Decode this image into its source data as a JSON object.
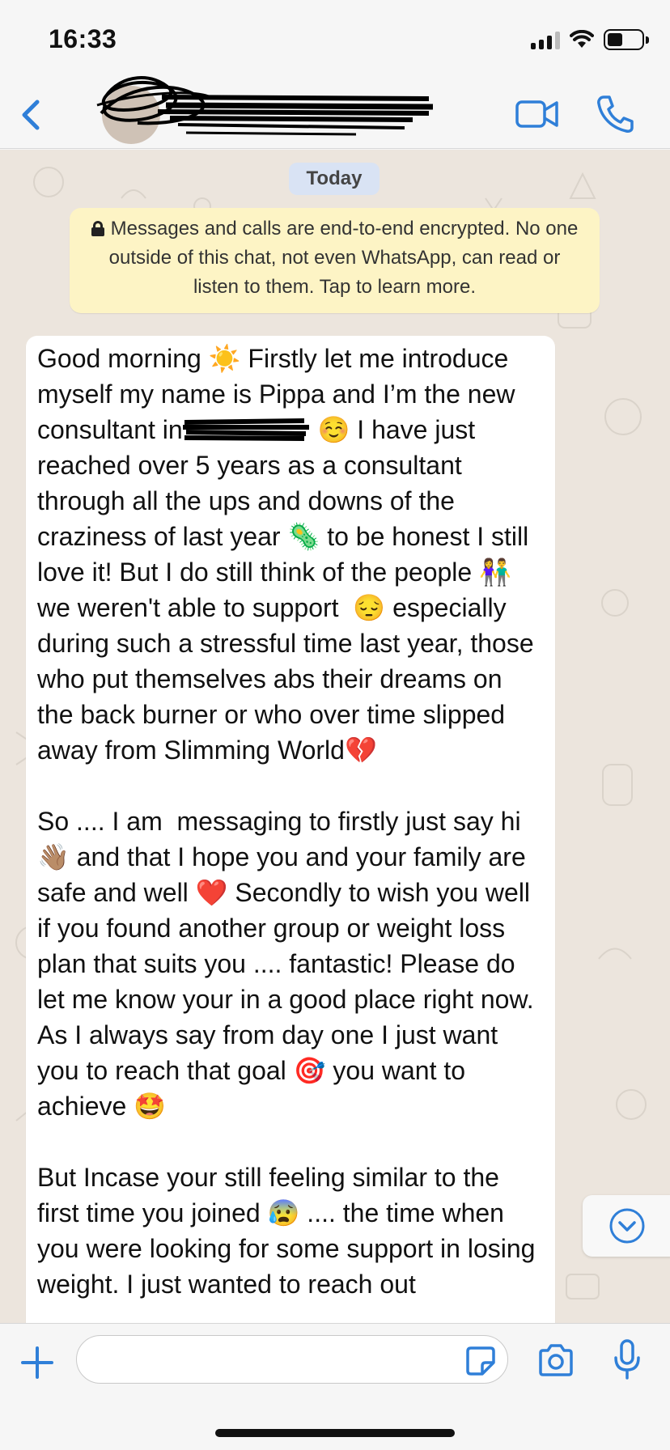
{
  "status_bar": {
    "time": "16:33",
    "battery_level": 0.45,
    "signal_bars": 3
  },
  "header": {
    "back_icon": "chevron-left-icon",
    "video_icon": "video-camera-icon",
    "call_icon": "phone-icon",
    "accent_color": "#2f7fd8"
  },
  "chat": {
    "date_chip": "Today",
    "encryption_notice": "Messages and calls are end-to-end encrypted. No one outside of this chat, not even WhatsApp, can read or listen to them. Tap to learn more.",
    "message": {
      "part1": "Good morning ☀️ Firstly let me introduce myself my name is Pippa and I’m the new consultant in",
      "part2": " ☺️ I have just reached over 5 years as a consultant through all the ups and downs of the craziness of last year 🦠 to be honest I still love it! But I do still think of the people 👫we weren't able to support  😔 especially during such a stressful time last year, those who put themselves abs their dreams on the back burner or who over time slipped away from Slimming World💔\n\nSo .... I am  messaging to firstly just say hi 👋🏽 and that I hope you and your family are safe and well ❤️ Secondly to wish you well if you found another group or weight loss plan that suits you .... fantastic! Please do let me know your in a good place right now. As I always say from day one I just want you to reach that goal 🎯 you want to achieve 🤩\n\nBut Incase your still feeling similar to the first time you joined 😰 .... the time when you were looking for some support in losing weight. I just wanted to reach out"
    }
  },
  "input_bar": {
    "input_value": "",
    "icons": [
      "plus-icon",
      "sticker-icon",
      "camera-icon",
      "microphone-icon"
    ]
  },
  "colors": {
    "chat_background": "#ece5dd",
    "encryption_background": "#fdf4c5",
    "date_chip_background": "#d9e3f4",
    "bubble_background": "#ffffff"
  }
}
